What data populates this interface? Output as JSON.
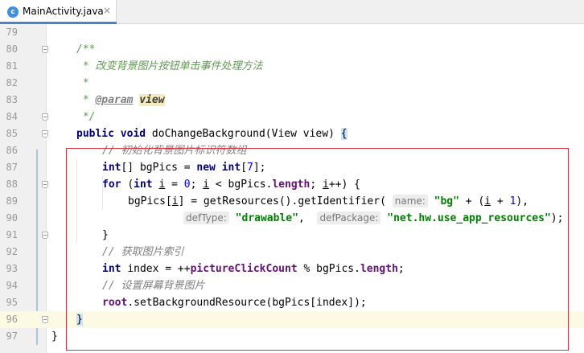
{
  "tab": {
    "icon_letter": "c",
    "title": "MainActivity.java",
    "close": "×"
  },
  "lines": [
    {
      "n": "79"
    },
    {
      "n": "80",
      "parts": [
        {
          "t": "/**",
          "c": "doc"
        }
      ]
    },
    {
      "n": "81",
      "parts": [
        {
          "t": " * 改变背景图片按钮单击事件处理方法",
          "c": "doc"
        }
      ]
    },
    {
      "n": "82",
      "parts": [
        {
          "t": " *",
          "c": "doc"
        }
      ]
    },
    {
      "n": "83",
      "parts": [
        {
          "t": " * ",
          "c": "doc"
        },
        {
          "t": "@param",
          "c": "doctag"
        },
        {
          "t": " ",
          "c": "doc"
        },
        {
          "t": "view",
          "c": "docparam"
        }
      ]
    },
    {
      "n": "84",
      "parts": [
        {
          "t": " */",
          "c": "doc"
        }
      ]
    },
    {
      "n": "85",
      "parts": [
        {
          "t": "public void ",
          "c": "kw"
        },
        {
          "t": "doChangeBackground(View view) "
        },
        {
          "t": "{",
          "c": "brace-hl"
        }
      ]
    },
    {
      "n": "86",
      "parts": [
        {
          "t": "// 初始化背景图片标识符数组",
          "c": "cmt"
        }
      ]
    },
    {
      "n": "87",
      "parts": [
        {
          "t": "int",
          "c": "kw"
        },
        {
          "t": "[] bgPics = "
        },
        {
          "t": "new int",
          "c": "kw"
        },
        {
          "t": "["
        },
        {
          "t": "7",
          "c": "num"
        },
        {
          "t": "];"
        }
      ]
    },
    {
      "n": "88",
      "parts": [
        {
          "t": "for ",
          "c": "kw"
        },
        {
          "t": "("
        },
        {
          "t": "int ",
          "c": "kw"
        },
        {
          "t": "i",
          "c": "uline"
        },
        {
          "t": " = "
        },
        {
          "t": "0",
          "c": "num"
        },
        {
          "t": "; "
        },
        {
          "t": "i",
          "c": "uline"
        },
        {
          "t": " < bgPics."
        },
        {
          "t": "length",
          "c": "fld"
        },
        {
          "t": "; "
        },
        {
          "t": "i",
          "c": "uline"
        },
        {
          "t": "++) {"
        }
      ]
    },
    {
      "n": "89",
      "parts": [
        {
          "t": "bgPics["
        },
        {
          "t": "i",
          "c": "uline"
        },
        {
          "t": "] = getResources().getIdentifier( "
        },
        {
          "t": "name:",
          "c": "hint"
        },
        {
          "t": " "
        },
        {
          "t": "\"bg\"",
          "c": "str"
        },
        {
          "t": " + ("
        },
        {
          "t": "i",
          "c": "uline"
        },
        {
          "t": " + "
        },
        {
          "t": "1",
          "c": "num"
        },
        {
          "t": "),"
        }
      ]
    },
    {
      "n": "90",
      "parts": [
        {
          "t": "defType:",
          "c": "hint"
        },
        {
          "t": " "
        },
        {
          "t": "\"drawable\"",
          "c": "str"
        },
        {
          "t": ",  "
        },
        {
          "t": "defPackage:",
          "c": "hint"
        },
        {
          "t": " "
        },
        {
          "t": "\"net.hw.use_app_resources\"",
          "c": "str"
        },
        {
          "t": ");"
        }
      ]
    },
    {
      "n": "91",
      "parts": [
        {
          "t": "}"
        }
      ]
    },
    {
      "n": "92",
      "parts": [
        {
          "t": "// 获取图片索引",
          "c": "cmt"
        }
      ]
    },
    {
      "n": "93",
      "parts": [
        {
          "t": "int ",
          "c": "kw"
        },
        {
          "t": "index = ++"
        },
        {
          "t": "pictureClickCount",
          "c": "fld"
        },
        {
          "t": " % bgPics."
        },
        {
          "t": "length",
          "c": "fld"
        },
        {
          "t": ";"
        }
      ]
    },
    {
      "n": "94",
      "parts": [
        {
          "t": "// 设置屏幕背景图片",
          "c": "cmt"
        }
      ]
    },
    {
      "n": "95",
      "parts": [
        {
          "t": "root",
          "c": "fld"
        },
        {
          "t": ".setBackgroundResource(bgPics[index]);"
        }
      ]
    },
    {
      "n": "96",
      "parts": [
        {
          "t": "}",
          "c": "brace-hl"
        }
      ]
    },
    {
      "n": "97",
      "parts": [
        {
          "t": "}"
        }
      ]
    }
  ]
}
